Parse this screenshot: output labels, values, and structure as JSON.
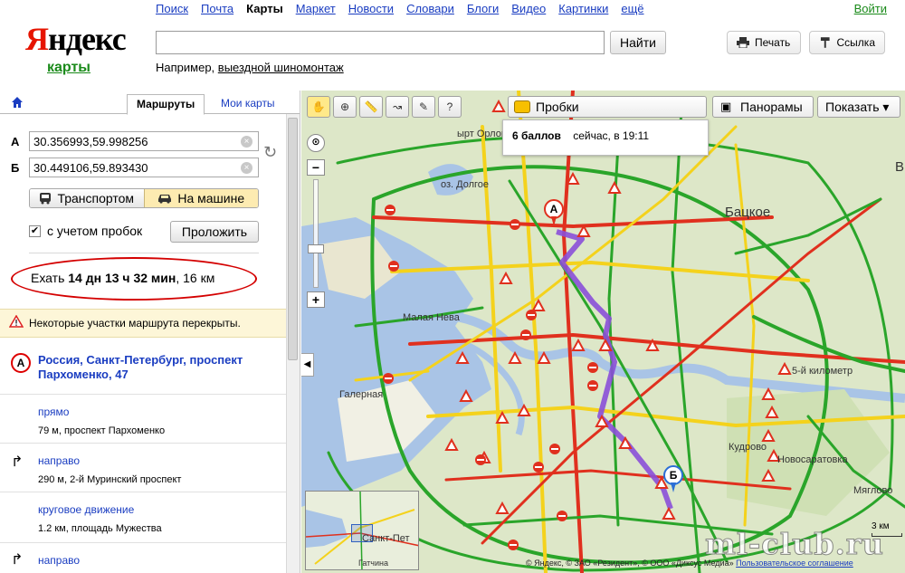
{
  "header": {
    "logo_first": "Я",
    "logo_rest": "ндекс",
    "logo_sub": "карты",
    "nav": [
      "Поиск",
      "Почта",
      "Карты",
      "Маркет",
      "Новости",
      "Словари",
      "Блоги",
      "Видео",
      "Картинки",
      "ещё"
    ],
    "nav_active_index": 2,
    "login": "Войти",
    "search_value": "",
    "search_button": "Найти",
    "example_prefix": "Например, ",
    "example_link": "выездной шиномонтаж",
    "print_label": "Печать",
    "link_label": "Ссылка"
  },
  "sidebar": {
    "tab_routes": "Маршруты",
    "tab_my_maps": "Мои карты",
    "from_label": "А",
    "to_label": "Б",
    "from_value": "30.356993,59.998256",
    "to_value": "30.449106,59.893430",
    "mode_transit": "Транспортом",
    "mode_car": "На машине",
    "traffic_label": "с учетом пробок",
    "traffic_checked": true,
    "route_button": "Проложить",
    "eta_prefix": "Ехать ",
    "eta_time": "14 дн 13 ч 32 мин",
    "eta_suffix": ", 16 км",
    "warning": "Некоторые участки маршрута перекрыты.",
    "start_marker": "А",
    "start_address": "Россия, Санкт-Петербург, проспект Пархоменко, 47",
    "steps": [
      {
        "dir": "прямо",
        "dist": "79 м, проспект Пархоменко",
        "arrow": ""
      },
      {
        "dir": "направо",
        "dist": "290 м, 2-й Муринский проспект",
        "arrow": "↱"
      },
      {
        "dir": "круговое движение",
        "dist": "1.2 км, площадь Мужества",
        "arrow": ""
      },
      {
        "dir": "направо",
        "dist": "",
        "arrow": "↱"
      }
    ]
  },
  "map": {
    "traffic_button": "Пробки",
    "traffic_score": "6 баллов",
    "traffic_time": "сейчас, в 19:11",
    "panorama_button": "Панорамы",
    "show_button": "Показать ▾",
    "marker_a": "А",
    "marker_b": "Б",
    "labels": {
      "orlovsky": "ырт Орловский",
      "dolgoe": "оз. Долгое",
      "bakcove": "Бацкое",
      "malaya_neva": "Малая Нева",
      "galernaya": "Галерная",
      "petro_region": "Петро...",
      "km5": "5-й километр",
      "kudrovo": "Кудрово",
      "novosaratovka": "Новосаратовка",
      "myagloevo": "Мяглово",
      "spb_edge": "В",
      "mini_city": "Санкт-Пет",
      "mini_town": "Гатчина"
    },
    "scale": "3 км",
    "copyright_text": "© Яндекс, © ЗАО «Резидент», © ООО «Диксус Медиа»",
    "copyright_link": "Пользовательское соглашение",
    "watermark": "ml-club.ru"
  },
  "colors": {
    "yandex_red": "#e61400",
    "link_blue": "#1a3dc1",
    "brand_green": "#1a8a1a",
    "route_purple": "#8a4fd8",
    "traffic_red": "#e0301e",
    "traffic_yellow": "#f4d21c",
    "traffic_green": "#2aa52a",
    "water": "#a9c4e6"
  }
}
